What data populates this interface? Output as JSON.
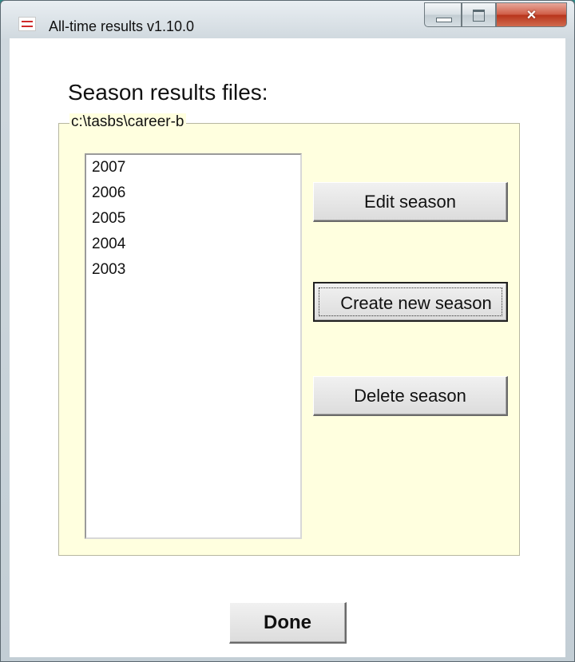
{
  "window": {
    "title": "All-time results v1.10.0",
    "icon": "app-icon",
    "controls": {
      "minimize": "minimize-icon",
      "maximize": "maximize-icon",
      "close": "×"
    }
  },
  "main": {
    "heading": "Season results files:",
    "group_label": "c:\\tasbs\\career-b",
    "seasons": [
      "2007",
      "2006",
      "2005",
      "2004",
      "2003"
    ],
    "buttons": {
      "edit": "Edit season",
      "create": "Create new season",
      "delete": "Delete season",
      "done": "Done"
    }
  }
}
